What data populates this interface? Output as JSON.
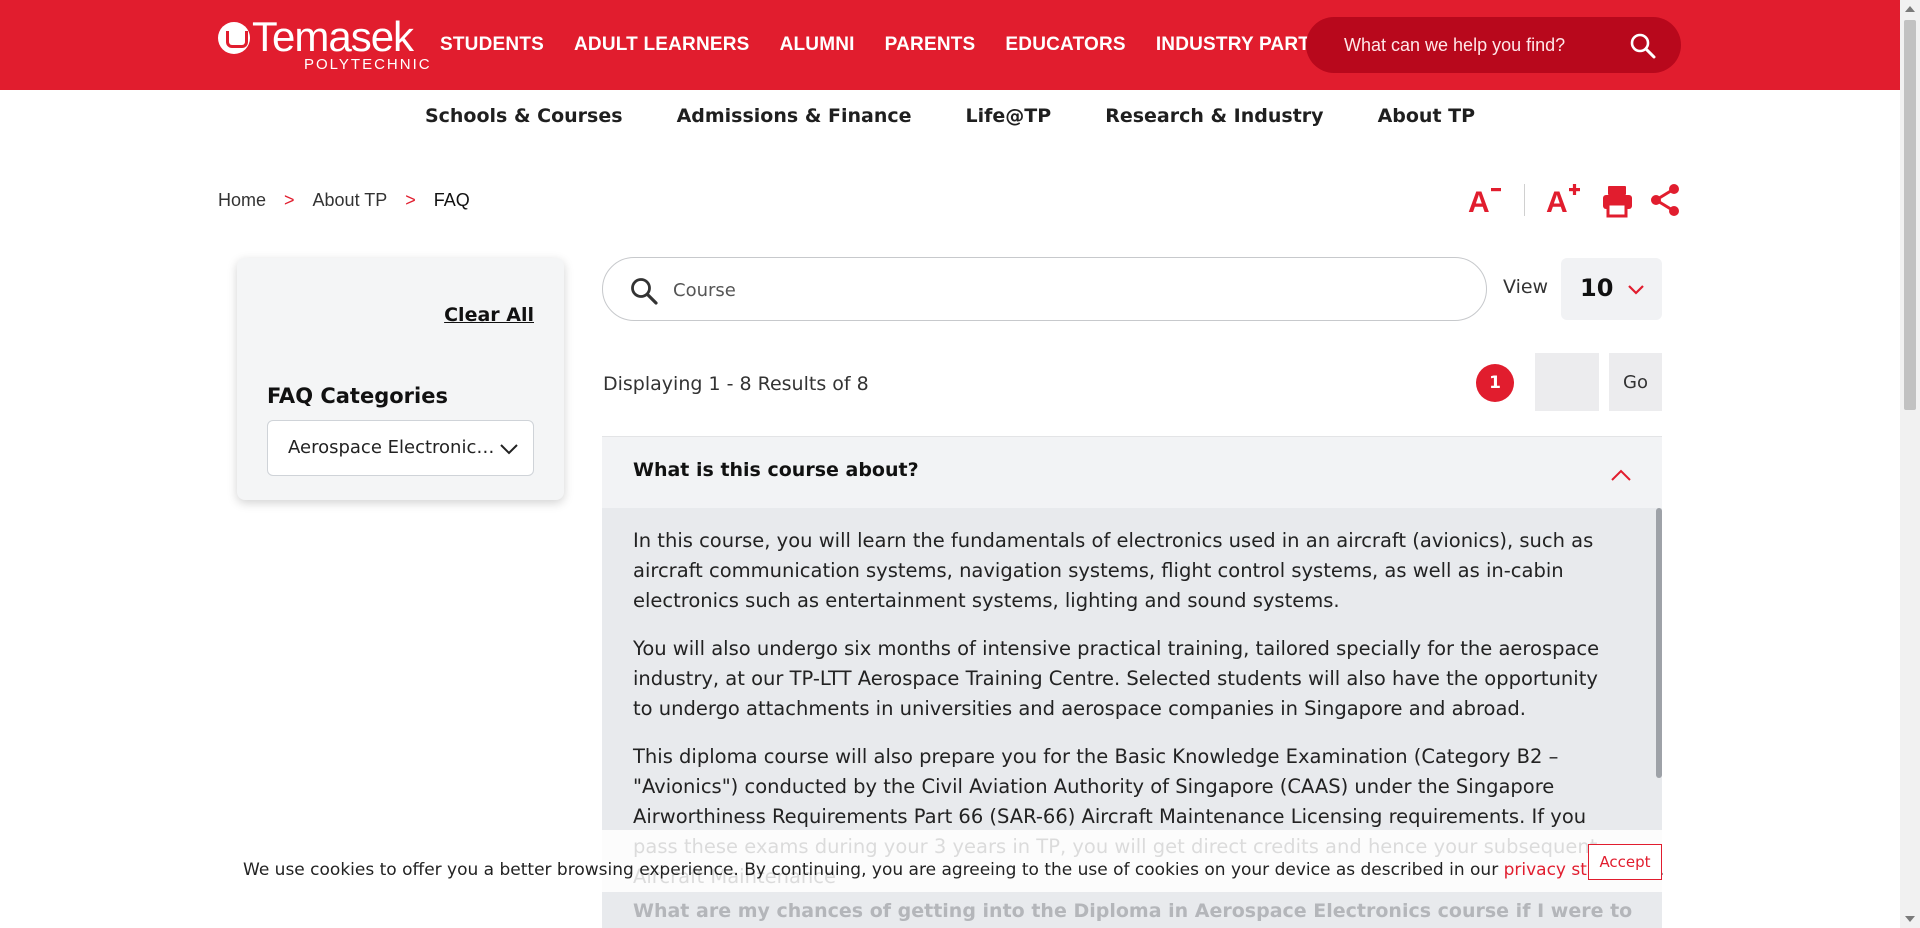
{
  "brand": {
    "name": "Temasek",
    "sub": "POLYTECHNIC",
    "accent": "#e11d2e"
  },
  "main_nav": [
    "STUDENTS",
    "ADULT LEARNERS",
    "ALUMNI",
    "PARENTS",
    "EDUCATORS",
    "INDUSTRY PARTNERS"
  ],
  "header_search": {
    "placeholder": "What can we help you find?",
    "icon": "search-icon"
  },
  "sub_nav": [
    "Schools & Courses",
    "Admissions & Finance",
    "Life@TP",
    "Research & Industry",
    "About TP"
  ],
  "breadcrumb": {
    "items": [
      "Home",
      "About TP"
    ],
    "current": "FAQ",
    "separator": ">"
  },
  "tools": {
    "icons": [
      "decrease-font-icon",
      "increase-font-icon",
      "print-icon",
      "share-icon"
    ]
  },
  "sidebar": {
    "clear_all": "Clear All",
    "categories_title": "FAQ Categories",
    "category_selected": "Aerospace Electronics ..."
  },
  "faq_search": {
    "value": "Course"
  },
  "view": {
    "label": "View",
    "selected": "10"
  },
  "results": {
    "info": "Displaying 1 - 8 Results of 8",
    "current_page": "1",
    "page_input_value": "",
    "go_label": "Go"
  },
  "faq": {
    "question": "What is this course about?",
    "answer": [
      "In this course, you will learn the fundamentals of electronics used in an aircraft (avionics), such as aircraft communication systems, navigation systems, flight control systems, as well as in-cabin electronics such as entertainment systems, lighting and sound systems.",
      "You will also undergo six months of intensive practical training, tailored specially for the aerospace industry, at our TP-LTT Aerospace Training Centre. Selected students will also have the opportunity to undergo attachments in universities and aerospace companies in Singapore and abroad.",
      "This diploma course will also prepare you for the Basic Knowledge Examination (Category B2 – \"Avionics\") conducted by the Civil Aviation Authority of Singapore (CAAS) under the Singapore Airworthiness Requirements Part 66 (SAR-66) Aircraft Maintenance Licensing requirements. If you pass these exams during your 3 years in TP, you will get direct credits and hence your subsequent Aircraft Maintenance"
    ],
    "next_question": "What are my chances of getting into the Diploma in Aerospace Electronics course if I were to"
  },
  "cookie": {
    "message": "We use cookies to offer you a better browsing experience. By continuing, you are agreeing to the use of cookies on your device as described in our ",
    "link": "privacy statement",
    "trail": ".",
    "accept": "Accept"
  }
}
